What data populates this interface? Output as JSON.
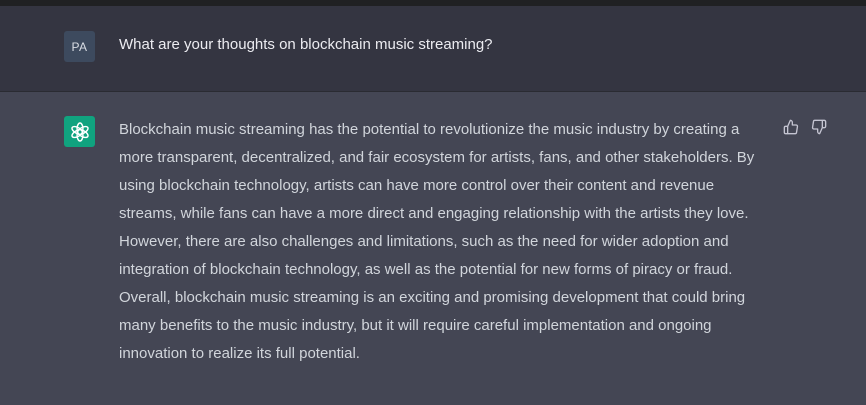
{
  "conversation": {
    "user": {
      "avatar_initials": "PA",
      "message": "What are your thoughts on blockchain music streaming?"
    },
    "assistant": {
      "avatar_icon": "openai-logo-icon",
      "message": "Blockchain music streaming has the potential to revolutionize the music industry by creating a more transparent, decentralized, and fair ecosystem for artists, fans, and other stakeholders. By using blockchain technology, artists can have more control over their content and revenue streams, while fans can have a more direct and engaging relationship with the artists they love. However, there are also challenges and limitations, such as the need for wider adoption and integration of blockchain technology, as well as the potential for new forms of piracy or fraud. Overall, blockchain music streaming is an exciting and promising development that could bring many benefits to the music industry, but it will require careful implementation and ongoing innovation to realize its full potential."
    },
    "feedback_icons": [
      "thumbs-up-icon",
      "thumbs-down-icon"
    ]
  },
  "colors": {
    "page_background": "#343541",
    "assistant_background": "#444654",
    "assistant_avatar": "#10a37f",
    "user_avatar": "#3d4a5e",
    "text_user": "#ececf1",
    "text_assistant": "#d1d5db"
  }
}
